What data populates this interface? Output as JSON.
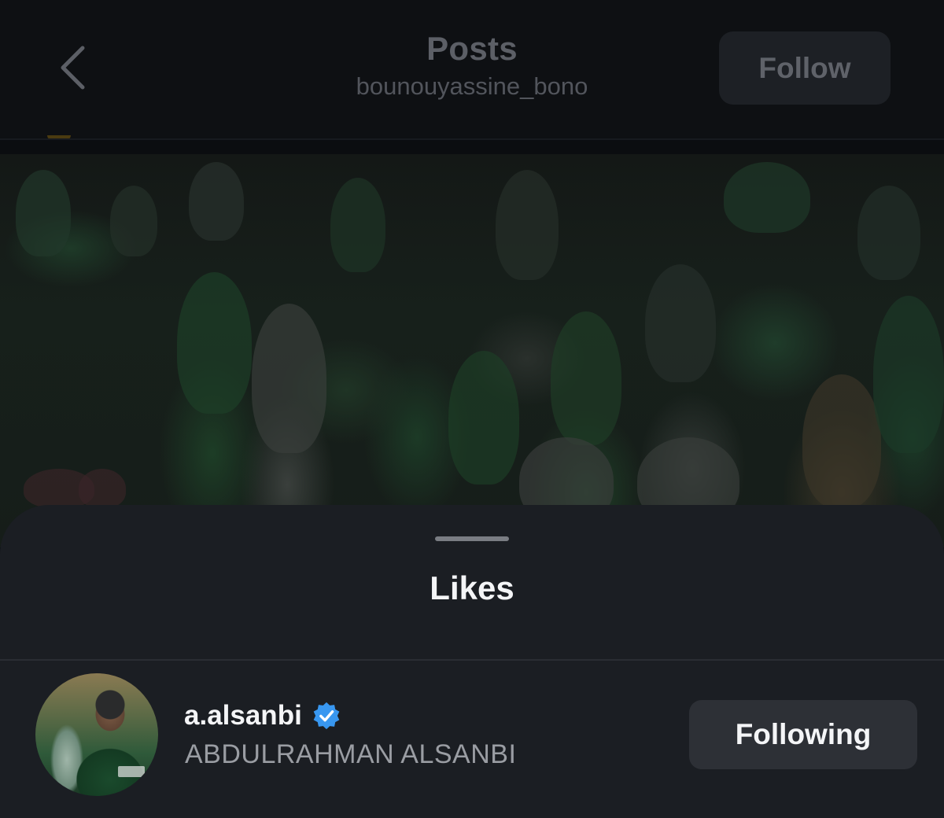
{
  "header": {
    "title": "Posts",
    "subtitle": "bounouyassine_bono",
    "follow_label": "Follow",
    "back_icon": "chevron-left-icon"
  },
  "sheet": {
    "title": "Likes"
  },
  "likes": [
    {
      "username": "a.alsanbi",
      "full_name": "ABDULRAHMAN ALSANBI",
      "verified": true,
      "button_label": "Following"
    }
  ],
  "colors": {
    "sheet_bg": "#1b1e23",
    "verified_blue": "#3897f0",
    "button_bg": "#2d3036",
    "text_primary": "#f4f5f7",
    "text_secondary": "#9a9da3"
  }
}
